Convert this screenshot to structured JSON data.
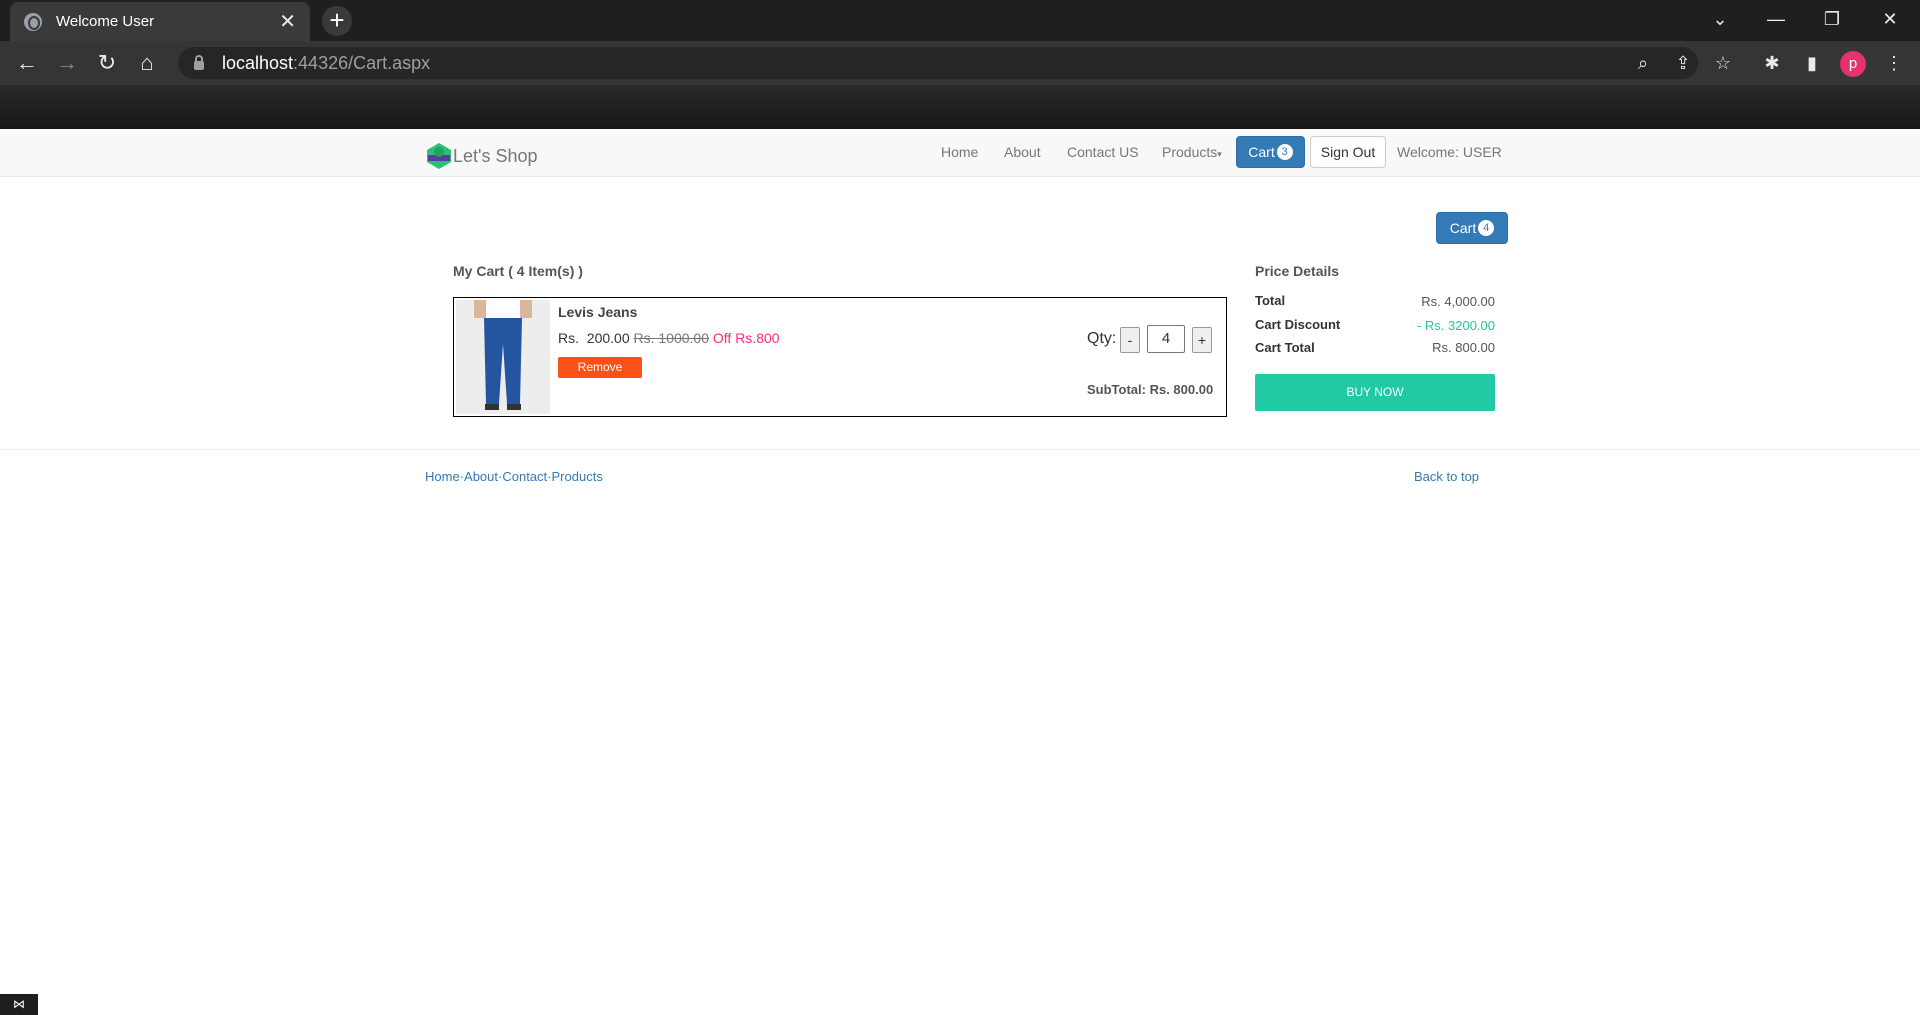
{
  "browser": {
    "tab_title": "Welcome User",
    "url_host": "localhost",
    "url_path": ":44326/Cart.aspx",
    "profile_initial": "p"
  },
  "site": {
    "brand": "Let's Shop",
    "nav": {
      "home": "Home",
      "about": "About",
      "contact": "Contact US",
      "products": "Products",
      "cart": "Cart",
      "cart_count": "3",
      "signout": "Sign Out",
      "welcome": "Welcome: USER"
    }
  },
  "cart": {
    "top_button_label": "Cart",
    "top_button_count": "4",
    "title": "My Cart ( 4 Item(s) )",
    "items": [
      {
        "name": "Levis Jeans",
        "currency": "Rs.",
        "price": "200.00",
        "original_price": "Rs.  1000.00",
        "off": "Off Rs.800",
        "remove_label": "Remove",
        "qty_label": "Qty:",
        "qty": "4",
        "minus": "-",
        "plus": "+",
        "subtotal": "SubTotal: Rs.  800.00"
      }
    ]
  },
  "price_details": {
    "title": "Price Details",
    "total_label": "Total",
    "total_value": "Rs. 4,000.00",
    "discount_label": "Cart Discount",
    "discount_value": "- Rs. 3200.00",
    "cart_total_label": "Cart Total",
    "cart_total_value": "Rs. 800.00",
    "buy_now": "BUY NOW"
  },
  "footer": {
    "links": [
      "Home",
      "About",
      "Contact",
      "Products"
    ],
    "back_to_top": "Back to top"
  },
  "colors": {
    "primary": "#337ab7",
    "buy": "#21c9a5",
    "remove": "#fd4f1a",
    "off": "#ff2a7a",
    "discount": "#21c997"
  }
}
